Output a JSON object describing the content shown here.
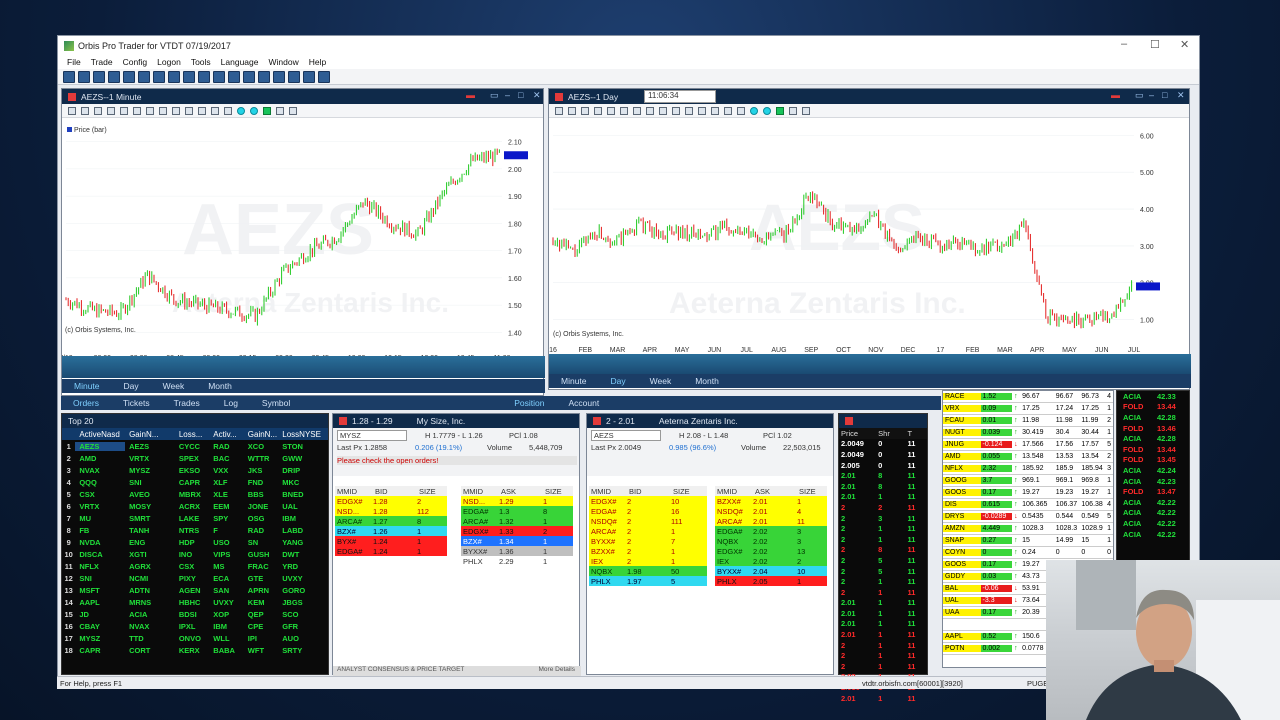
{
  "window": {
    "title": "Orbis Pro Trader for VTDT 07/19/2017",
    "controls": [
      "–",
      "☐",
      "✕"
    ]
  },
  "menu": [
    "File",
    "Trade",
    "Config",
    "Logon",
    "Tools",
    "Language",
    "Window",
    "Help"
  ],
  "chart1": {
    "title": "AEZS--1 Minute",
    "legend": "Price (bar)",
    "copyright": "(c) Orbis Systems, Inc.",
    "watermark": "AEZS",
    "watermark2": "Aeterna Zentaris Inc.",
    "last_price_marker": "1.9x",
    "tabs": [
      "Minute",
      "Day",
      "Week",
      "Month"
    ],
    "active_tab": "Minute"
  },
  "chart2": {
    "title": "AEZS--1 Day",
    "time_box": "11:06:34",
    "copyright": "(c) Orbis Systems, Inc.",
    "watermark": "AEZS",
    "watermark2": "Aeterna Zentaris Inc.",
    "tabs": [
      "Minute",
      "Day",
      "Week",
      "Month"
    ],
    "active_tab": "Day"
  },
  "chart_data": [
    {
      "type": "bar",
      "title": "AEZS--1 Minute",
      "x": [
        "7/19",
        "08:00",
        "08:30",
        "08:45",
        "09:00",
        "09:15",
        "09:30",
        "09:45",
        "10:00",
        "10:15",
        "10:30",
        "10:45",
        "11:00"
      ],
      "yticks": [
        "2.10",
        "2.00",
        "1.90",
        "1.80",
        "1.70",
        "1.60",
        "1.50",
        "1.40"
      ],
      "ylim": [
        1.35,
        2.15
      ],
      "series": [
        {
          "name": "Price (bar)",
          "values": [
            1.52,
            1.48,
            1.47,
            1.61,
            1.52,
            1.5,
            1.48,
            1.46,
            1.62,
            1.7,
            1.75,
            1.88,
            1.8,
            1.76,
            1.92,
            2.03,
            2.05
          ]
        }
      ]
    },
    {
      "type": "bar",
      "title": "AEZS--1 Day",
      "x": [
        "16",
        "FEB",
        "MAR",
        "APR",
        "MAY",
        "JUN",
        "JUL",
        "AUG",
        "SEP",
        "OCT",
        "NOV",
        "DEC",
        "17",
        "FEB",
        "MAR",
        "APR",
        "MAY",
        "JUN",
        "JUL"
      ],
      "yticks": [
        "6.00",
        "5.00",
        "4.00",
        "3.00",
        "2.00",
        "1.00"
      ],
      "ylim": [
        0.5,
        6.2
      ],
      "series": [
        {
          "name": "Price (bar)",
          "values": [
            3.2,
            2.8,
            3.4,
            3.1,
            3.6,
            3.3,
            3.4,
            3.2,
            3.5,
            3.3,
            3.2,
            3.4,
            4.5,
            3.6,
            3.4,
            3.8,
            2.9,
            3.3,
            3.0,
            3.1,
            2.9,
            3.0,
            3.6,
            1.1,
            1.0,
            1.05,
            1.1,
            1.9
          ]
        }
      ]
    }
  ],
  "lower_tabs": {
    "left": [
      "Orders",
      "Tickets",
      "Trades",
      "Log",
      "Symbol"
    ],
    "right": [
      "Position",
      "Account"
    ]
  },
  "top20": {
    "title": "Top 20",
    "headers": [
      "ActiveNasd",
      "GainN...",
      "Loss...",
      "Activ...",
      "GainN...",
      "LossNYSE"
    ],
    "rows": [
      [
        "AEZS",
        "AEZS",
        "CYCC",
        "RAD",
        "XCO",
        "STON"
      ],
      [
        "AMD",
        "VRTX",
        "SPEX",
        "BAC",
        "WTTR",
        "GWW"
      ],
      [
        "NVAX",
        "MYSZ",
        "EKSO",
        "VXX",
        "JKS",
        "DRIP"
      ],
      [
        "QQQ",
        "SNI",
        "CAPR",
        "XLF",
        "FND",
        "MKC"
      ],
      [
        "CSX",
        "AVEO",
        "MBRX",
        "XLE",
        "BBS",
        "BNED"
      ],
      [
        "VRTX",
        "MOSY",
        "ACRX",
        "EEM",
        "JONE",
        "UAL"
      ],
      [
        "MU",
        "SMRT",
        "LAKE",
        "SPY",
        "OSG",
        "IBM"
      ],
      [
        "FB",
        "TANH",
        "NTRS",
        "F",
        "RAD",
        "LABD"
      ],
      [
        "NVDA",
        "ENG",
        "HDP",
        "USO",
        "SN",
        "YANG"
      ],
      [
        "DISCA",
        "XGTI",
        "INO",
        "VIPS",
        "GUSH",
        "DWT"
      ],
      [
        "NFLX",
        "AGRX",
        "CSX",
        "MS",
        "FRAC",
        "YRD"
      ],
      [
        "SNI",
        "NCMI",
        "PIXY",
        "ECA",
        "GTE",
        "UVXY"
      ],
      [
        "MSFT",
        "ADTN",
        "AGEN",
        "SAN",
        "APRN",
        "GORO"
      ],
      [
        "AAPL",
        "MRNS",
        "HBHC",
        "UVXY",
        "KEM",
        "JBGS"
      ],
      [
        "JD",
        "ACIA",
        "BDSI",
        "XOP",
        "QEP",
        "SCO"
      ],
      [
        "CBAY",
        "NVAX",
        "IPXL",
        "IBM",
        "CPE",
        "GFR"
      ],
      [
        "MYSZ",
        "TTD",
        "ONVO",
        "WLL",
        "IPI",
        "AUO"
      ],
      [
        "CAPR",
        "CORT",
        "KERX",
        "BABA",
        "WFT",
        "SRTY"
      ]
    ]
  },
  "l2_mysz": {
    "title": "1.28 - 1.29",
    "name": "My Size, Inc.",
    "symbol": "MYSZ",
    "hl": "H 1.7779 - L 1.26",
    "pcl": "PCl 1.08",
    "last": "Last Px  1.2858",
    "chg": "0.206 (19.1%)",
    "vol_label": "Volume",
    "vol": "5,448,709",
    "note": "Please check the open orders!",
    "bid": [
      [
        "EDGX#",
        "1.28",
        "2",
        "y"
      ],
      [
        "NSD...",
        "1.28",
        "112",
        "y"
      ],
      [
        "ARCA#",
        "1.27",
        "8",
        "g"
      ],
      [
        "BZX#",
        "1.26",
        "1",
        "cy"
      ],
      [
        "BYX#",
        "1.24",
        "1",
        "r"
      ],
      [
        "EDGA#",
        "1.24",
        "1",
        "r"
      ]
    ],
    "ask": [
      [
        "NSD...",
        "1.29",
        "1",
        "y"
      ],
      [
        "EDGA#",
        "1.3",
        "8",
        "g"
      ],
      [
        "ARCA#",
        "1.32",
        "1",
        "g"
      ],
      [
        "EDGX#",
        "1.33",
        "2",
        "r"
      ],
      [
        "BZX#",
        "1.34",
        "1",
        "b"
      ],
      [
        "BYXX#",
        "1.36",
        "1",
        "gr"
      ],
      [
        "PHLX",
        "2.29",
        "1",
        "wt"
      ]
    ],
    "footer": "ANALYST CONSENSUS & PRICE TARGET",
    "footer2": "More Details"
  },
  "l2_aezs": {
    "title": "2 - 2.01",
    "name": "Aeterna Zentaris Inc.",
    "symbol": "AEZS",
    "hl": "H 2.08 - L 1.48",
    "pcl": "PCl 1.02",
    "last": "Last Px  2.0049",
    "chg": "0.985 (96.6%)",
    "vol_label": "Volume",
    "vol": "22,503,015",
    "bid": [
      [
        "EDGX#",
        "2",
        "10",
        "y"
      ],
      [
        "EDGA#",
        "2",
        "16",
        "y"
      ],
      [
        "NSDQ#",
        "2",
        "111",
        "y"
      ],
      [
        "ARCA#",
        "2",
        "1",
        "y"
      ],
      [
        "BYXX#",
        "2",
        "7",
        "y"
      ],
      [
        "BZXX#",
        "2",
        "1",
        "y"
      ],
      [
        "IEX",
        "2",
        "1",
        "y"
      ],
      [
        "NQBX",
        "1.98",
        "50",
        "g"
      ],
      [
        "PHLX",
        "1.97",
        "5",
        "cy"
      ]
    ],
    "ask": [
      [
        "BZXX#",
        "2.01",
        "1",
        "y"
      ],
      [
        "NSDQ#",
        "2.01",
        "4",
        "y"
      ],
      [
        "ARCA#",
        "2.01",
        "11",
        "y"
      ],
      [
        "EDGA#",
        "2.02",
        "3",
        "g"
      ],
      [
        "NQBX",
        "2.02",
        "3",
        "g"
      ],
      [
        "EDGX#",
        "2.02",
        "13",
        "g"
      ],
      [
        "IEX",
        "2.02",
        "2",
        "g"
      ],
      [
        "BYXX#",
        "2.04",
        "10",
        "cy"
      ],
      [
        "PHLX",
        "2.05",
        "1",
        "r"
      ]
    ]
  },
  "ts": {
    "headers": [
      "Price",
      "Shr",
      "T"
    ],
    "rows": [
      [
        "2.0049",
        "0",
        "11"
      ],
      [
        "2.0049",
        "0",
        "11"
      ],
      [
        "2.005",
        "0",
        "11"
      ],
      [
        "2.01",
        "8",
        "11"
      ],
      [
        "2.01",
        "8",
        "11"
      ],
      [
        "2.01",
        "1",
        "11"
      ],
      [
        "2",
        "2",
        "11"
      ],
      [
        "2",
        "3",
        "11"
      ],
      [
        "2",
        "1",
        "11"
      ],
      [
        "2",
        "1",
        "11"
      ],
      [
        "2",
        "8",
        "11"
      ],
      [
        "2",
        "5",
        "11"
      ],
      [
        "2",
        "5",
        "11"
      ],
      [
        "2",
        "1",
        "11"
      ],
      [
        "2",
        "1",
        "11"
      ],
      [
        "2.01",
        "1",
        "11"
      ],
      [
        "2.01",
        "1",
        "11"
      ],
      [
        "2.01",
        "1",
        "11"
      ],
      [
        "2.01",
        "1",
        "11"
      ],
      [
        "2",
        "1",
        "11"
      ],
      [
        "2",
        "1",
        "11"
      ],
      [
        "2",
        "1",
        "11"
      ],
      [
        "2.02",
        "1",
        "11"
      ],
      [
        "2.016",
        "1",
        "11"
      ],
      [
        "2.01",
        "1",
        "11"
      ]
    ]
  },
  "watchlist": {
    "rows": [
      [
        "RACE",
        "1.52",
        "96.67",
        "96.67",
        "96.73",
        "4",
        "up"
      ],
      [
        "VRX",
        "0.09",
        "17.25",
        "17.24",
        "17.25",
        "1",
        "up"
      ],
      [
        "FCAU",
        "0.01",
        "11.98",
        "11.98",
        "11.99",
        "2",
        "up"
      ],
      [
        "NUGT",
        "0.039",
        "30.419",
        "30.4",
        "30.44",
        "1",
        "up"
      ],
      [
        "JNUG",
        "-0.124",
        "17.566",
        "17.56",
        "17.57",
        "5",
        "dn"
      ],
      [
        "AMD",
        "0.055",
        "13.548",
        "13.53",
        "13.54",
        "2",
        "up"
      ],
      [
        "NFLX",
        "2.32",
        "185.92",
        "185.9",
        "185.94",
        "3",
        "up"
      ],
      [
        "GOOG",
        "3.7",
        "969.1",
        "969.1",
        "969.8",
        "1",
        "up"
      ],
      [
        "GOOS",
        "0.17",
        "19.27",
        "19.23",
        "19.27",
        "1",
        "up"
      ],
      [
        "DIS",
        "0.615",
        "106.365",
        "106.37",
        "106.38",
        "4",
        "up"
      ],
      [
        "DRYS",
        "-0.0289",
        "0.5435",
        "0.544",
        "0.549",
        "5",
        "dn"
      ],
      [
        "AMZN",
        "4.449",
        "1028.3",
        "1028.3",
        "1028.9",
        "1",
        "up"
      ],
      [
        "SNAP",
        "0.27",
        "15",
        "14.99",
        "15",
        "1",
        "up"
      ],
      [
        "COYN",
        "0",
        "0.24",
        "0",
        "0",
        "0",
        "up"
      ],
      [
        "GOOS",
        "0.17",
        "19.27",
        "",
        "",
        "",
        "up"
      ],
      [
        "GDDY",
        "0.03",
        "43.73",
        "",
        "",
        "",
        "up"
      ],
      [
        "BAL",
        "-0.06",
        "53.91",
        "",
        "",
        "",
        "dn"
      ],
      [
        "UAL",
        "-3.3",
        "73.64",
        "",
        "",
        "",
        "dn"
      ],
      [
        "UAA",
        "0.17",
        "20.39",
        "",
        "",
        "",
        "up"
      ],
      [
        "",
        "",
        "",
        "",
        "",
        "",
        ""
      ],
      [
        "AAPL",
        "0.52",
        "150.6",
        "",
        "",
        "",
        "up"
      ],
      [
        "POTN",
        "0.002",
        "0.0778",
        "",
        "",
        "",
        "up"
      ]
    ]
  },
  "ecn": {
    "rows": [
      [
        "ACIA",
        "42.33",
        "g"
      ],
      [
        "FOLD",
        "13.44",
        "r"
      ],
      [
        "ACIA",
        "42.28",
        "g"
      ],
      [
        "FOLD",
        "13.46",
        "r"
      ],
      [
        "ACIA",
        "42.28",
        "g"
      ],
      [
        "FOLD",
        "13.44",
        "r"
      ],
      [
        "FOLD",
        "13.45",
        "r"
      ],
      [
        "ACIA",
        "42.24",
        "g"
      ],
      [
        "ACIA",
        "42.23",
        "g"
      ],
      [
        "FOLD",
        "13.47",
        "r"
      ],
      [
        "ACIA",
        "42.22",
        "g"
      ],
      [
        "ACIA",
        "42.22",
        "g"
      ],
      [
        "ACIA",
        "42.22",
        "g"
      ],
      [
        "ACIA",
        "42.22",
        "g"
      ]
    ]
  },
  "status": {
    "left": "For Help, press F1",
    "right": "vtdtr.orbisfn.com[60001][3920]",
    "right2": "PUGE"
  }
}
